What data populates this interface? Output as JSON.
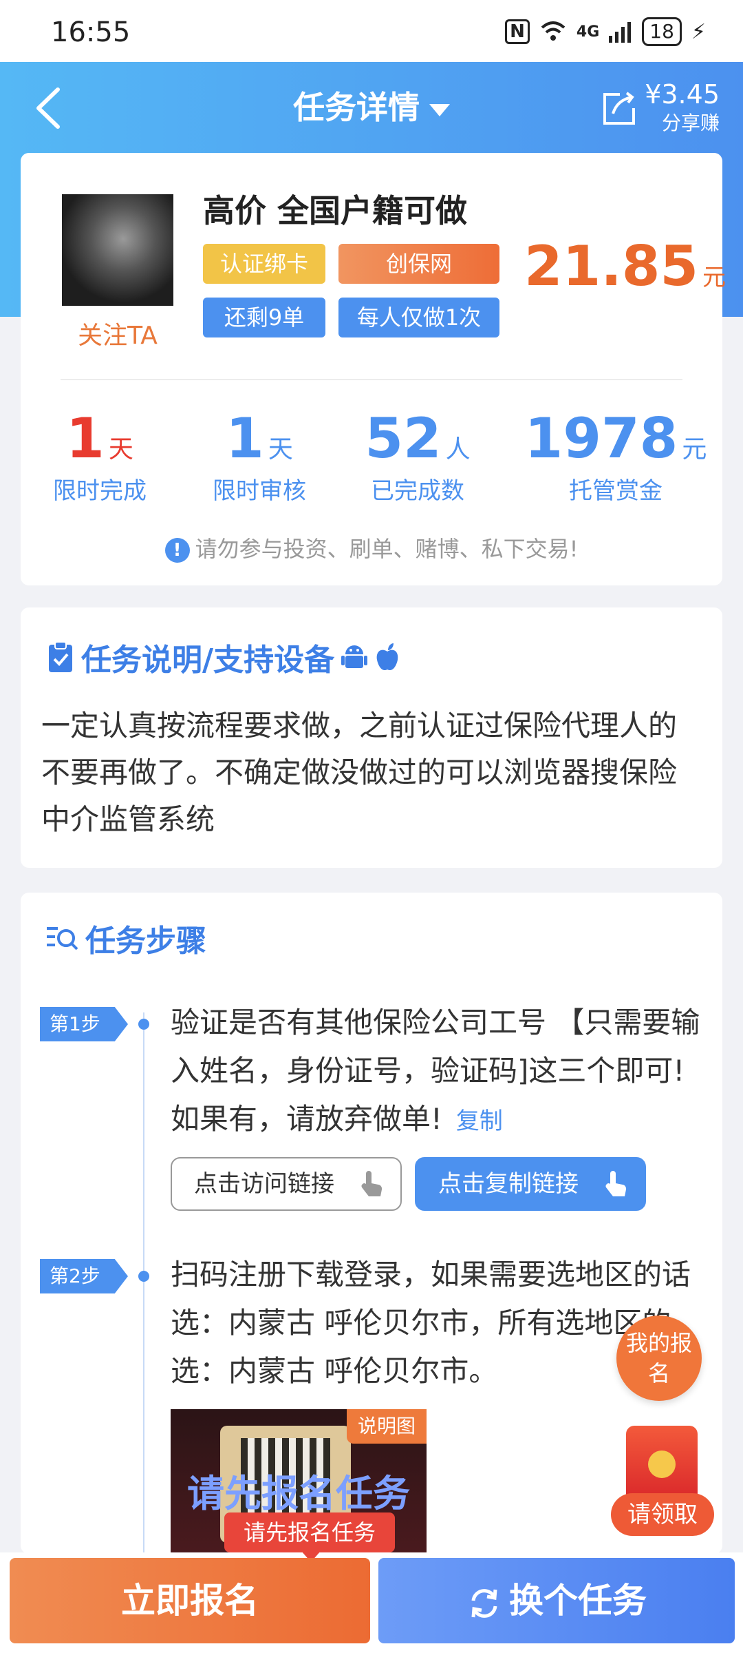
{
  "status_bar": {
    "time": "16:55",
    "network": "4G",
    "battery": "18"
  },
  "header": {
    "title": "任务详情",
    "share_amount": "¥3.45",
    "share_label": "分享赚"
  },
  "task": {
    "follow": "关注TA",
    "name": "高价 全国户籍可做",
    "tags": [
      "认证绑卡",
      "创保网",
      "还剩9单",
      "每人仅做1次"
    ],
    "price": "21.85",
    "price_unit": "元"
  },
  "stats": [
    {
      "value": "1",
      "unit": "天",
      "label": "限时完成",
      "color": "#e83b2f"
    },
    {
      "value": "1",
      "unit": "天",
      "label": "限时审核",
      "color": "#4c91ef"
    },
    {
      "value": "52",
      "unit": "人",
      "label": "已完成数",
      "color": "#4c91ef"
    },
    {
      "value": "1978",
      "unit": "元",
      "label": "托管赏金",
      "color": "#4c91ef"
    }
  ],
  "warning": "请勿参与投资、刷单、赌博、私下交易!",
  "description": {
    "title": "任务说明/支持设备",
    "text": "一定认真按流程要求做，之前认证过保险代理人的不要再做了。不确定做没做过的可以浏览器搜保险中介监管系统"
  },
  "steps_section": {
    "title": "任务步骤",
    "steps": [
      {
        "badge": "第1步",
        "text": "验证是否有其他保险公司工号 【只需要输入姓名，身份证号，验证码]这三个即可!如果有，请放弃做单!",
        "copy": "复制"
      },
      {
        "badge": "第2步",
        "text": "扫码注册下载登录，如果需要选地区的话选：内蒙古 呼伦贝尔市，所有选地区的选：内蒙古 呼伦贝尔市。"
      }
    ],
    "visit_button": "点击访问链接",
    "copy_button": "点击复制链接",
    "image_tag": "说明图",
    "image_overlay": "请先报名任务"
  },
  "floats": {
    "my_signup": "我的报名",
    "receive": "请领取"
  },
  "bottom": {
    "tip": "请先报名任务",
    "signup": "立即报名",
    "switch": "换个任务"
  },
  "colors": {
    "accent_blue": "#4c91ef",
    "accent_orange": "#ec6b33",
    "price": "#e9692c"
  }
}
